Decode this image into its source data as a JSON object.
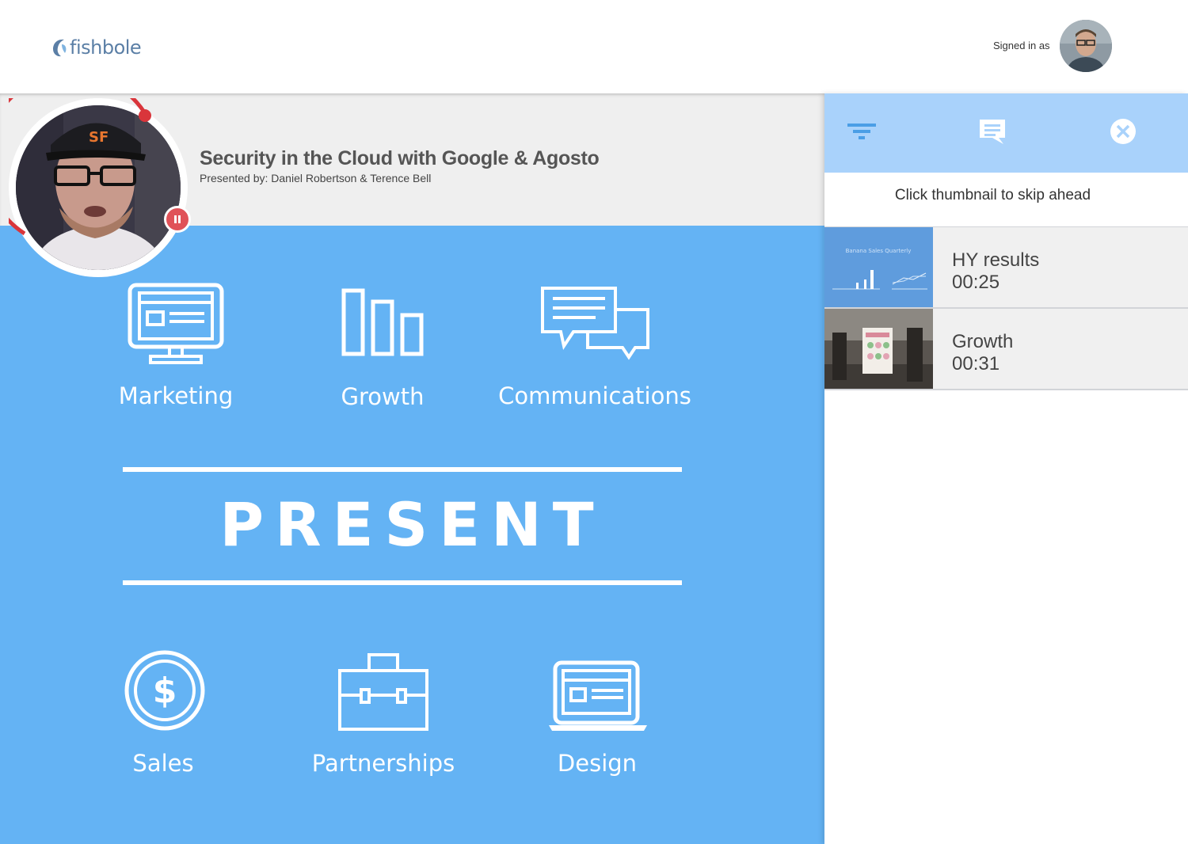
{
  "brand": {
    "logo_text": "fishbole",
    "logo_color": "#5b7fa6"
  },
  "header": {
    "signed_in_label": "Signed in as"
  },
  "session": {
    "title": "Security in the Cloud with Google & Agosto",
    "presenters": "Presented by: Daniel Robertson & Terence Bell"
  },
  "slide": {
    "background": "#64b3f4",
    "heading": "PRESENT",
    "top_items": [
      {
        "label": "Marketing",
        "icon": "monitor-icon"
      },
      {
        "label": "Growth",
        "icon": "bar-chart-icon"
      },
      {
        "label": "Communications",
        "icon": "chat-bubbles-icon"
      }
    ],
    "bottom_items": [
      {
        "label": "Sales",
        "icon": "dollar-coin-icon"
      },
      {
        "label": "Partnerships",
        "icon": "briefcase-icon"
      },
      {
        "label": "Design",
        "icon": "laptop-icon"
      }
    ]
  },
  "sidebar": {
    "toolbar": [
      {
        "icon": "filter-icon"
      },
      {
        "icon": "comment-icon"
      },
      {
        "icon": "close-circle-icon"
      }
    ],
    "hint": "Click thumbnail to skip ahead",
    "chapters": [
      {
        "title": "HY results",
        "time": "00:25",
        "thumb_caption": "Banana Sales Quarterly"
      },
      {
        "title": "Growth",
        "time": "00:31"
      }
    ]
  },
  "colors": {
    "accent_light": "#a9d2fb",
    "record_red": "#d9353b",
    "toolbar_icon": "#4a9ee6"
  }
}
